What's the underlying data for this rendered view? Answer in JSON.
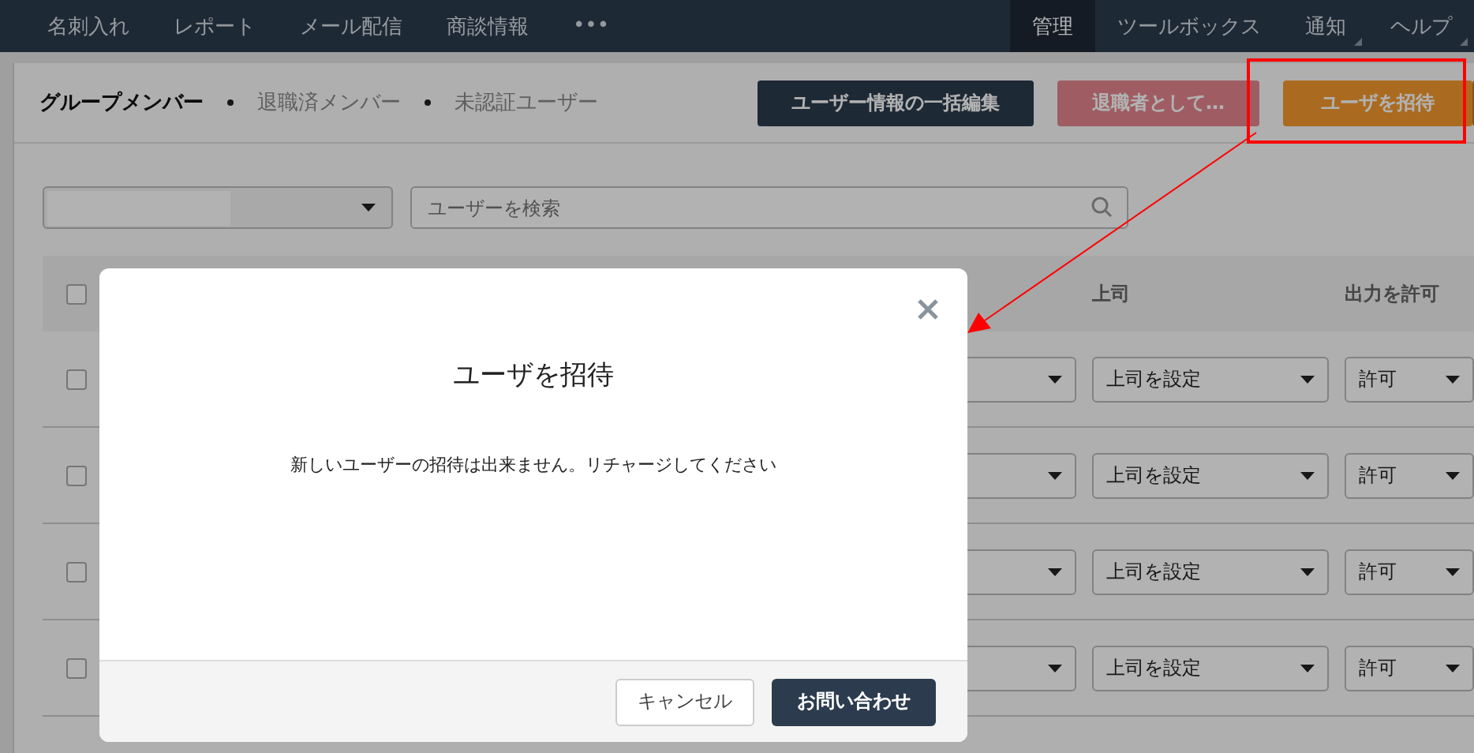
{
  "nav": {
    "left": [
      {
        "label": "名刺入れ",
        "selected": false
      },
      {
        "label": "レポート",
        "selected": false
      },
      {
        "label": "メール配信",
        "selected": false
      },
      {
        "label": "商談情報",
        "selected": false
      },
      {
        "label": "•••",
        "selected": false
      }
    ],
    "right": [
      {
        "label": "管理",
        "selected": true,
        "menu": false
      },
      {
        "label": "ツールボックス",
        "selected": false,
        "menu": false
      },
      {
        "label": "通知",
        "selected": false,
        "menu": true
      },
      {
        "label": "ヘルプ",
        "selected": false,
        "menu": true
      }
    ]
  },
  "tabs": [
    {
      "label": "グループメンバー",
      "selected": true
    },
    {
      "label": "退職済メンバー",
      "selected": false
    },
    {
      "label": "未認証ユーザー",
      "selected": false
    }
  ],
  "actions": [
    {
      "label": "ユーザー情報の一括編集",
      "kind": "dark"
    },
    {
      "label": "退職者として…",
      "kind": "disabled"
    },
    {
      "label": "ユーザを招待",
      "kind": "primary"
    }
  ],
  "filter": {
    "search_placeholder": "ユーザーを検索"
  },
  "table": {
    "select_all_checked": false,
    "columns": [
      "上司",
      "出力を許可"
    ],
    "rows": [
      {
        "checked": false,
        "supervisor": "上司を設定",
        "permission": "許可"
      },
      {
        "checked": false,
        "supervisor": "上司を設定",
        "permission": "許可"
      },
      {
        "checked": false,
        "supervisor": "上司を設定",
        "permission": "許可"
      },
      {
        "checked": false,
        "supervisor": "上司を設定",
        "permission": "許可"
      }
    ]
  },
  "modal": {
    "title": "ユーザを招待",
    "message": "新しいユーザーの招待は出来ません。リチャージしてください",
    "buttons": [
      {
        "label": "キャンセル",
        "kind": "secondary"
      },
      {
        "label": "お問い合わせ",
        "kind": "primary"
      }
    ]
  }
}
